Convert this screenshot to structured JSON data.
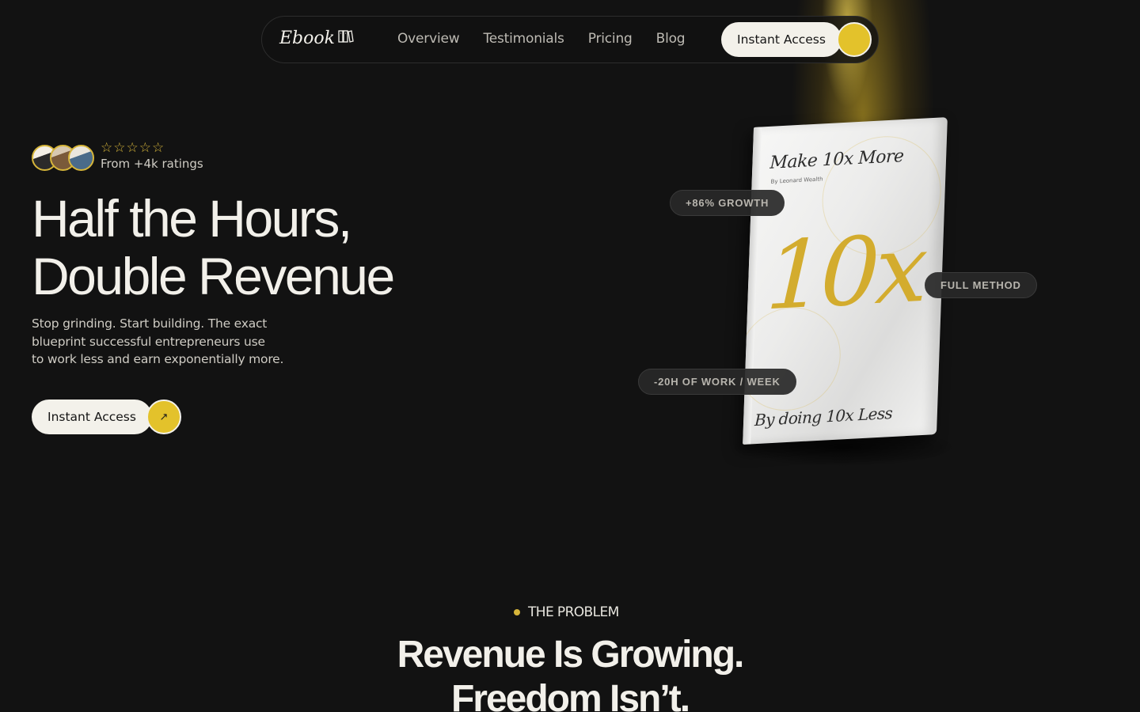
{
  "nav": {
    "logo": "Ebook",
    "logo_icon": "book-icon",
    "links": [
      "Overview",
      "Testimonials",
      "Pricing",
      "Blog"
    ],
    "cta": "Instant Access"
  },
  "hero": {
    "stars": "☆☆☆☆☆",
    "rating_text": "From +4k ratings",
    "title_line1": "Half the Hours,",
    "title_line2": "Double Revenue",
    "subtitle_line1": "Stop grinding. Start building. The exact",
    "subtitle_line2": "blueprint successful entrepreneurs use",
    "subtitle_line3": "to work less and earn exponentially more.",
    "cta": "Instant Access",
    "arrow": "↗"
  },
  "book": {
    "title": "Make 10x More",
    "author": "By Leonard Wealth",
    "big": "10x",
    "bottom": "By doing 10x Less"
  },
  "badges": {
    "growth": "+86% GROWTH",
    "method": "FULL METHOD",
    "work": "-20H OF WORK / WEEK"
  },
  "problem": {
    "eyebrow": "THE PROBLEM",
    "title_line1": "Revenue Is Growing.",
    "title_line2": "Freedom Isn’t."
  },
  "colors": {
    "background": "#121212",
    "accent": "#e3c22b",
    "button": "#f3f1ea"
  }
}
